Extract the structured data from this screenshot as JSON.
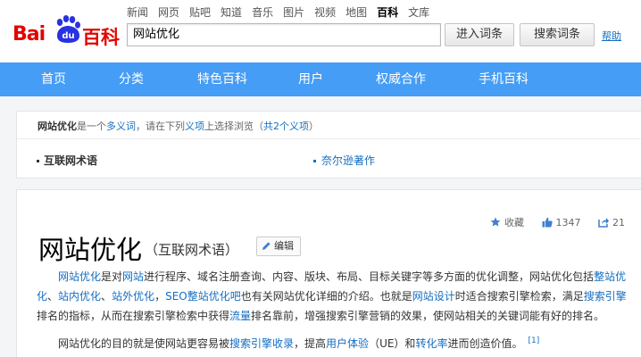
{
  "logo": {
    "bai": "Bai",
    "du": "du",
    "baike": "百科"
  },
  "topnav": [
    "新闻",
    "网页",
    "贴吧",
    "知道",
    "音乐",
    "图片",
    "视频",
    "地图",
    "百科",
    "文库"
  ],
  "topnav_active": "百科",
  "search": {
    "value": "网站优化",
    "enter_label": "进入词条",
    "search_label": "搜索词条",
    "help_label": "帮助"
  },
  "mainnav": [
    "首页",
    "分类",
    "特色百科",
    "用户",
    "权威合作",
    "手机百科"
  ],
  "polysemy": {
    "term": "网站优化",
    "t1": "是一个",
    "link1": "多义词",
    "t2": "，请在下列",
    "link2": "义项",
    "t3": "上选择浏览（",
    "link3": "共2个义项",
    "t4": "）",
    "items": [
      "互联网术语",
      "奈尔逊著作"
    ]
  },
  "actions": {
    "favorite": "收藏",
    "likes": "1347",
    "shares": "21"
  },
  "article": {
    "title": "网站优化",
    "subtitle": "（互联网术语）",
    "edit_label": "编辑",
    "p1": [
      {
        "t": "网站优化",
        "l": true
      },
      {
        "t": "是对",
        "l": false
      },
      {
        "t": "网站",
        "l": true
      },
      {
        "t": "进行程序、域名注册查询、内容、版块、布局、目标关键字等多方面的优化调整，网站优化包括",
        "l": false
      },
      {
        "t": "整站优化",
        "l": true
      },
      {
        "t": "、",
        "l": false
      },
      {
        "t": "站内优化",
        "l": true
      },
      {
        "t": "、",
        "l": false
      },
      {
        "t": "站外优化",
        "l": true
      },
      {
        "t": "，",
        "l": false
      },
      {
        "t": "SEO整站优化吧",
        "l": true
      },
      {
        "t": "也有关网站优化详细的介绍。也就是",
        "l": false
      },
      {
        "t": "网站设计",
        "l": true
      },
      {
        "t": "时适合搜索引擎检索，满足",
        "l": false
      },
      {
        "t": "搜索引擎",
        "l": true
      },
      {
        "t": "排名的指标，从而在搜索引擎检索中获得",
        "l": false
      },
      {
        "t": "流量",
        "l": true
      },
      {
        "t": "排名靠前，增强搜索引擎营销的效果，使网站相关的关键词能有好的排名。",
        "l": false
      }
    ],
    "p2": [
      {
        "t": "网站优化的目的就是使网站更容易被",
        "l": false
      },
      {
        "t": "搜索引擎收录",
        "l": true
      },
      {
        "t": "，提高",
        "l": false
      },
      {
        "t": "用户体验",
        "l": true
      },
      {
        "t": "（UE）和",
        "l": false
      },
      {
        "t": "转化率",
        "l": true
      },
      {
        "t": "进而创造价值。",
        "l": false
      }
    ],
    "ref": "[1]"
  },
  "colors": {
    "brand_red": "#e10601",
    "logo_blue": "#2932e1",
    "nav_blue": "#459df5",
    "link_blue": "#136ec2"
  },
  "icons": [
    "paw-icon",
    "star-icon",
    "thumbs-up-icon",
    "share-icon",
    "pencil-icon"
  ]
}
